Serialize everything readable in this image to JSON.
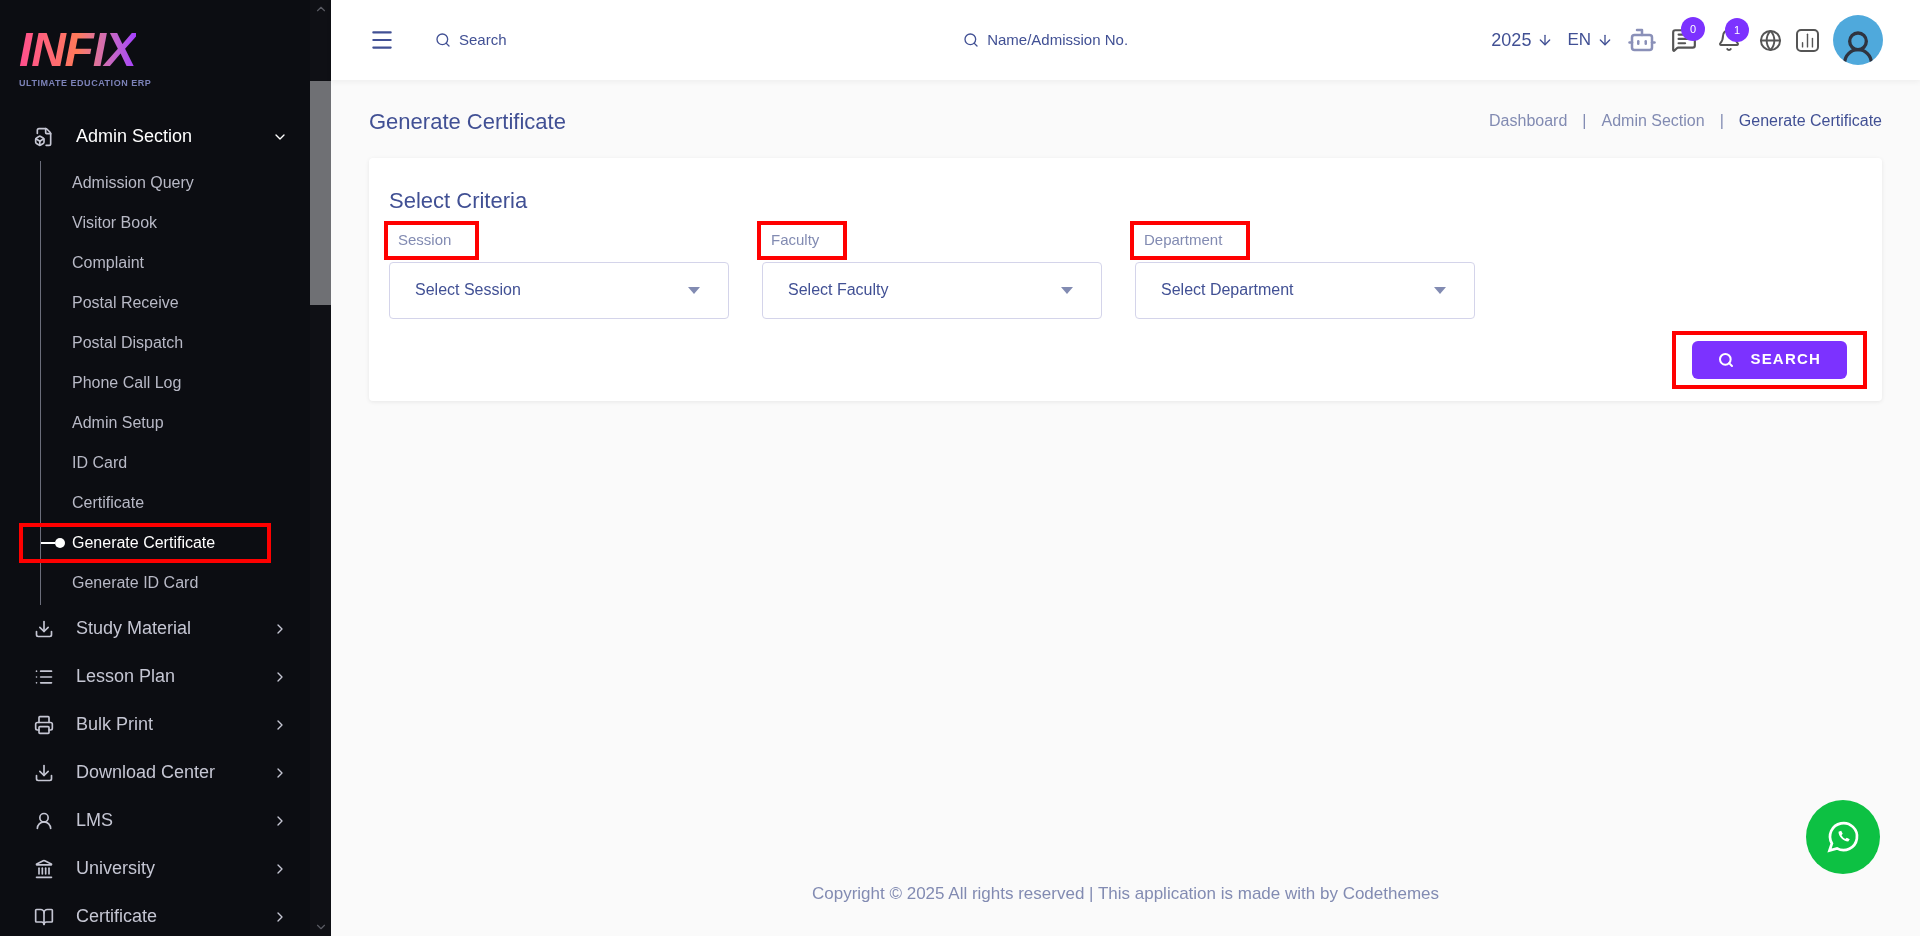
{
  "logo": {
    "name": "INFIX",
    "tagline": "ULTIMATE EDUCATION ERP"
  },
  "sidebar": {
    "items": [
      {
        "label": "Admin Section",
        "expanded": true,
        "children": [
          {
            "label": "Admission Query",
            "selected": false,
            "highlighted": false
          },
          {
            "label": "Visitor Book",
            "selected": false,
            "highlighted": false
          },
          {
            "label": "Complaint",
            "selected": false,
            "highlighted": false
          },
          {
            "label": "Postal Receive",
            "selected": false,
            "highlighted": false
          },
          {
            "label": "Postal Dispatch",
            "selected": false,
            "highlighted": false
          },
          {
            "label": "Phone Call Log",
            "selected": false,
            "highlighted": false
          },
          {
            "label": "Admin Setup",
            "selected": false,
            "highlighted": false
          },
          {
            "label": "ID Card",
            "selected": false,
            "highlighted": false
          },
          {
            "label": "Certificate",
            "selected": false,
            "highlighted": false
          },
          {
            "label": "Generate Certificate",
            "selected": true,
            "highlighted": true
          },
          {
            "label": "Generate ID Card",
            "selected": false,
            "highlighted": false
          }
        ]
      },
      {
        "label": "Study Material",
        "expanded": false
      },
      {
        "label": "Lesson Plan",
        "expanded": false
      },
      {
        "label": "Bulk Print",
        "expanded": false
      },
      {
        "label": "Download Center",
        "expanded": false
      },
      {
        "label": "LMS",
        "expanded": false
      },
      {
        "label": "University",
        "expanded": false
      },
      {
        "label": "Certificate",
        "expanded": false
      }
    ]
  },
  "header": {
    "search": {
      "placeholder": "Search"
    },
    "student_search": {
      "placeholder": "Name/Admission No."
    },
    "year": "2025",
    "language": "EN",
    "messages_badge": "0",
    "notifications_badge": "1"
  },
  "page": {
    "title": "Generate Certificate",
    "separator": "|",
    "breadcrumbs": [
      {
        "label": "Dashboard",
        "selected": false
      },
      {
        "label": "Admin Section",
        "selected": false
      },
      {
        "label": "Generate Certificate",
        "selected": true
      }
    ]
  },
  "card": {
    "title": "Select Criteria",
    "fields": [
      {
        "label": "Session",
        "value": "Select Session",
        "highlighted": true
      },
      {
        "label": "Faculty",
        "value": "Select Faculty",
        "highlighted": true
      },
      {
        "label": "Department",
        "value": "Select Department",
        "highlighted": true
      }
    ],
    "button": {
      "label": "SEARCH",
      "highlighted": true
    }
  },
  "footer": "Copyright © 2025 All rights reserved | This application is made with by Codethemes"
}
